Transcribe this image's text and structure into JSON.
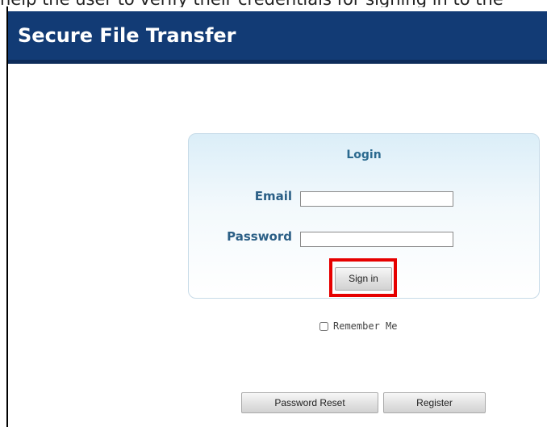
{
  "caption": "help the user to verify their credentials for signing in to the",
  "header": {
    "title": "Secure File Transfer",
    "bg_color": "#123b75"
  },
  "login": {
    "title": "Login",
    "email_label": "Email",
    "email_value": "",
    "password_label": "Password",
    "password_value": "",
    "signin_label": "Sign in"
  },
  "remember_me": {
    "label": "Remember Me",
    "checked": false
  },
  "footer_buttons": {
    "password_reset_label": "Password Reset",
    "register_label": "Register"
  },
  "highlight_color": "#e60000"
}
